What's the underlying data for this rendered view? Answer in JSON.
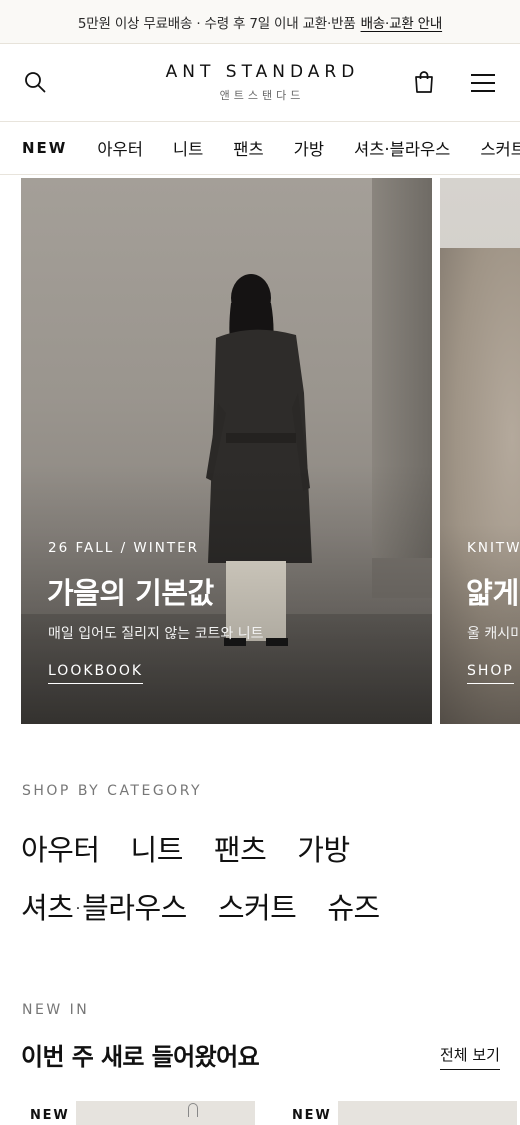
{
  "announcement": {
    "text": "5만원 이상 무료배송 · 수령 후 7일 이내 교환·반품",
    "link": "배송·교환 안내"
  },
  "header": {
    "brand_en": "ANT STANDARD",
    "brand_ko": "앤트스탠다드",
    "icons": [
      "search-icon",
      "bag-icon",
      "menu-icon"
    ]
  },
  "category_nav": {
    "items": [
      "NEW",
      "아우터",
      "니트",
      "팬츠",
      "가방",
      "셔츠·블라우스",
      "스커트"
    ]
  },
  "hero": {
    "slides": [
      {
        "eyebrow": "26 FALL / WINTER",
        "title": "가을의 기본값",
        "desc": "매일 입어도 질리지 않는 코트와 니트",
        "cta": "LOOKBOOK"
      },
      {
        "eyebrow": "KNITW",
        "title": "얇게",
        "desc": "울 캐시미",
        "cta": "SHOP"
      }
    ]
  },
  "shop_by_category": {
    "label": "SHOP BY CATEGORY",
    "row1": [
      "아우터",
      "니트",
      "팬츠",
      "가방"
    ],
    "row2": [
      "셔츠·블라우스",
      "스커트",
      "슈즈"
    ]
  },
  "new_in": {
    "label": "NEW IN",
    "title": "이번 주 새로 들어왔어요",
    "view_all": "전체 보기",
    "products": [
      {
        "badge": "NEW"
      },
      {
        "badge": "NEW"
      }
    ]
  },
  "colors": {
    "announce_bg": "#faf9f6",
    "text": "#111111",
    "muted": "#777777",
    "border": "#e8e4dc"
  }
}
